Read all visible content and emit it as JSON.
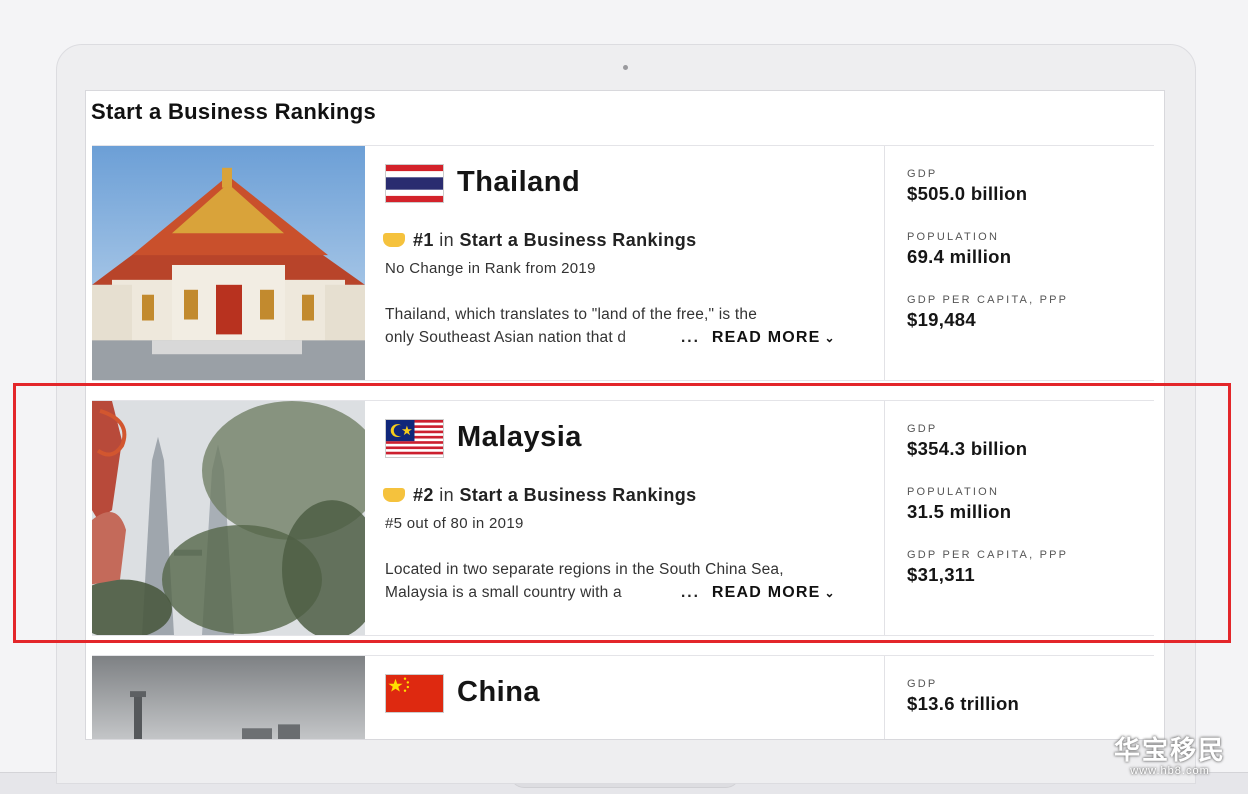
{
  "page": {
    "title": "Start a Business Rankings"
  },
  "cards": [
    {
      "country": "Thailand",
      "rank": "#1",
      "rank_in": "in",
      "ranking_name": "Start a Business Rankings",
      "sub": "No Change in Rank from 2019",
      "desc_line1": "Thailand, which translates to \"land of the free,\" is the",
      "desc_line2": "only Southeast Asian nation that d",
      "ellipsis": "...",
      "read_more": "READ MORE",
      "stats": [
        {
          "label": "GDP",
          "value": "$505.0 billion"
        },
        {
          "label": "POPULATION",
          "value": "69.4 million"
        },
        {
          "label": "GDP PER CAPITA, PPP",
          "value": "$19,484"
        }
      ]
    },
    {
      "country": "Malaysia",
      "rank": "#2",
      "rank_in": "in",
      "ranking_name": "Start a Business Rankings",
      "sub": "#5 out of 80 in 2019",
      "desc_line1": "Located in two separate regions in the South China Sea,",
      "desc_line2": "Malaysia is a small country with a",
      "ellipsis": "...",
      "read_more": "READ MORE",
      "stats": [
        {
          "label": "GDP",
          "value": "$354.3 billion"
        },
        {
          "label": "POPULATION",
          "value": "31.5 million"
        },
        {
          "label": "GDP PER CAPITA, PPP",
          "value": "$31,311"
        }
      ]
    },
    {
      "country": "China",
      "stats": [
        {
          "label": "GDP",
          "value": "$13.6 trillion"
        }
      ]
    }
  ],
  "watermark": {
    "chars": "华宝移民",
    "url": "www.hb8.com"
  },
  "colors": {
    "highlight": "#e3262a",
    "badge": "#f5c23d"
  },
  "icons": {
    "rank_badge": "gold-ribbon-icon",
    "read_more_chevron": "chevron-down-icon"
  }
}
